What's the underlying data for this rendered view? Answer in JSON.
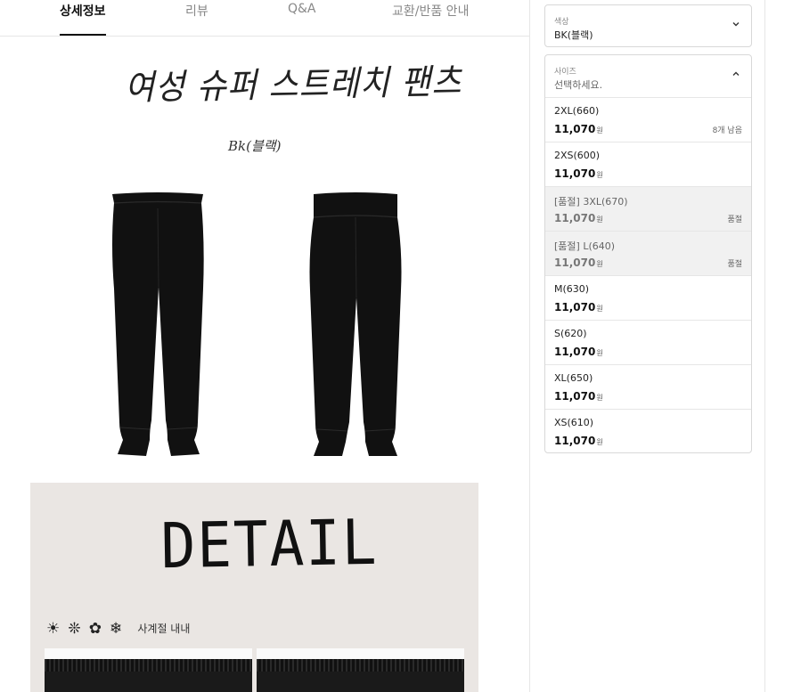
{
  "tabs": [
    {
      "label": "상세정보",
      "active": true
    },
    {
      "label": "리뷰",
      "active": false
    },
    {
      "label": "Q&A",
      "active": false
    },
    {
      "label": "교환/반품 안내",
      "active": false
    }
  ],
  "detail": {
    "title": "여성 슈퍼 스트레치 팬츠",
    "color_note": "Bk(블랙)",
    "detail_heading": "DETAIL",
    "season_icons": [
      "sun-icon",
      "snowflake-icon",
      "flower-icon",
      "snowflake-icon"
    ],
    "season_label": "사계절 내내"
  },
  "options": {
    "color": {
      "label": "색상",
      "value": "BK(블랙)",
      "icon": "chevron-down-icon"
    },
    "size": {
      "label": "사이즈",
      "placeholder": "선택하세요.",
      "icon": "chevron-up-icon",
      "currency": "원",
      "items": [
        {
          "name": "2XL(660)",
          "price": "11,070",
          "status": "8개 남음"
        },
        {
          "name": "2XS(600)",
          "price": "11,070",
          "status": ""
        },
        {
          "name": "[품절] 3XL(670)",
          "price": "11,070",
          "status": "품절"
        },
        {
          "name": "[품절] L(640)",
          "price": "11,070",
          "status": "품절"
        },
        {
          "name": "M(630)",
          "price": "11,070",
          "status": ""
        },
        {
          "name": "S(620)",
          "price": "11,070",
          "status": ""
        },
        {
          "name": "XL(650)",
          "price": "11,070",
          "status": ""
        },
        {
          "name": "XS(610)",
          "price": "11,070",
          "status": ""
        }
      ]
    }
  },
  "colors": {
    "active_tab": "#111111",
    "soldout_bg": "#f1f1f1",
    "detail_panel_bg": "#eae6e3",
    "pants": "#111111"
  }
}
